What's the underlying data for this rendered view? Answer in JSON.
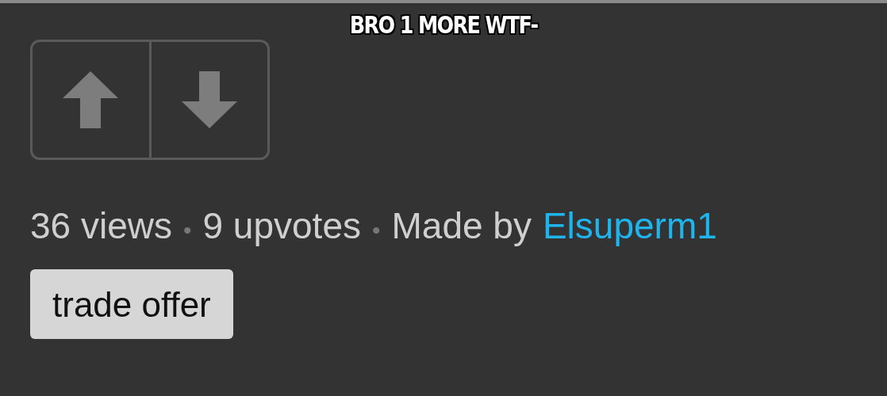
{
  "caption": "BRO 1 MORE WTF-",
  "vote_buttons": [
    {
      "kind": "up"
    },
    {
      "kind": "down"
    }
  ],
  "stats": [
    {
      "kind": "text",
      "text": "36 views"
    },
    {
      "kind": "separator",
      "text": "•"
    },
    {
      "kind": "text",
      "text": "9 upvotes"
    },
    {
      "kind": "separator",
      "text": "•"
    },
    {
      "kind": "text",
      "text": "Made by"
    },
    {
      "kind": "link",
      "text": "Elsuperm1"
    }
  ],
  "tags": [
    "trade offer"
  ]
}
